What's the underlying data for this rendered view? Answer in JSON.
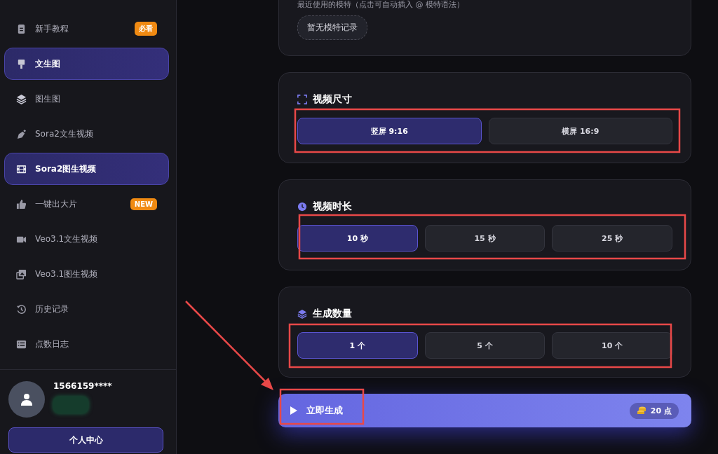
{
  "sidebar": {
    "items": [
      {
        "label": "新手教程",
        "badge": "必看",
        "selected": false
      },
      {
        "label": "文生图",
        "selected": true
      },
      {
        "label": "图生图",
        "selected": false
      },
      {
        "label": "Sora2文生视频",
        "selected": false
      },
      {
        "label": "Sora2图生视频",
        "selected": true
      },
      {
        "label": "一键出大片",
        "badge": "NEW",
        "selected": false
      },
      {
        "label": "Veo3.1文生视频",
        "selected": false
      },
      {
        "label": "Veo3.1图生视频",
        "selected": false
      },
      {
        "label": "历史记录",
        "selected": false
      },
      {
        "label": "点数日志",
        "selected": false
      }
    ],
    "user": {
      "name": "1566159****",
      "button": "个人中心"
    }
  },
  "models": {
    "hint": "最近使用的模特（点击可自动插入 @ 模特语法）",
    "empty": "暂无模特记录"
  },
  "sections": [
    {
      "title": "视频尺寸",
      "options": [
        {
          "label": "竖屏 9:16",
          "selected": true
        },
        {
          "label": "横屏 16:9",
          "selected": false
        }
      ]
    },
    {
      "title": "视频时长",
      "options": [
        {
          "label": "10 秒",
          "selected": true
        },
        {
          "label": "15 秒",
          "selected": false
        },
        {
          "label": "25 秒",
          "selected": false
        }
      ]
    },
    {
      "title": "生成数量",
      "options": [
        {
          "label": "1 个",
          "selected": true
        },
        {
          "label": "5 个",
          "selected": false
        },
        {
          "label": "10 个",
          "selected": false
        }
      ]
    }
  ],
  "generate": {
    "label": "立即生成",
    "cost": "20 点"
  }
}
